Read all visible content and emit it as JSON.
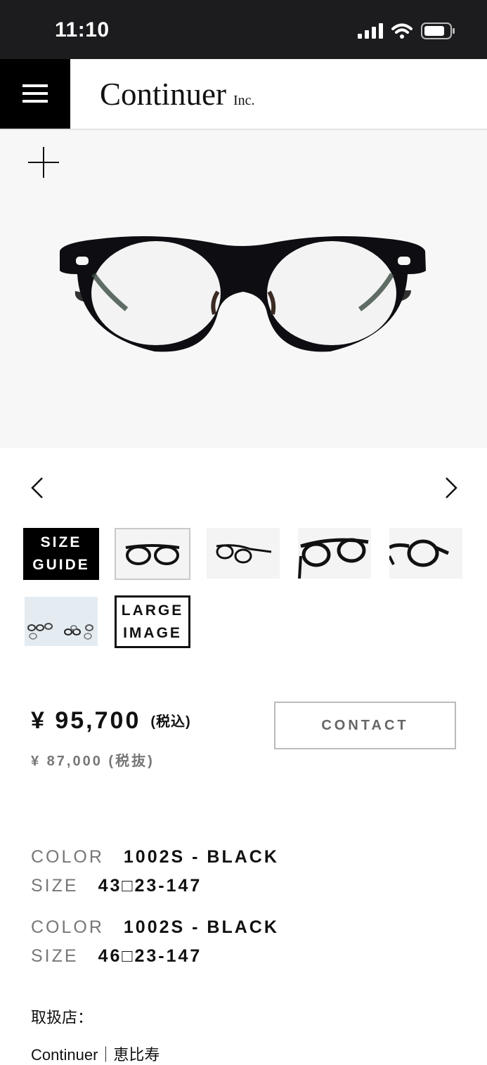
{
  "status_bar": {
    "time": "11:10"
  },
  "header": {
    "logo": "Continuer",
    "logo_suffix": "Inc."
  },
  "gallery": {
    "size_guide_line1": "SIZE",
    "size_guide_line2": "GUIDE",
    "large_image_line1": "LARGE",
    "large_image_line2": "IMAGE"
  },
  "pricing": {
    "price_incl": "¥ 95,700",
    "tax_incl_label": "(税込)",
    "price_excl": "¥ 87,000 (税抜)",
    "contact_label": "CONTACT"
  },
  "specs": [
    {
      "color_key": "COLOR",
      "color_value": "1002S - BLACK",
      "size_key": "SIZE",
      "size_value": "43□23-147"
    },
    {
      "color_key": "COLOR",
      "color_value": "1002S - BLACK",
      "size_key": "SIZE",
      "size_value": "46□23-147"
    }
  ],
  "shop": {
    "label": "取扱店：",
    "name": "Continuer｜恵比寿"
  }
}
